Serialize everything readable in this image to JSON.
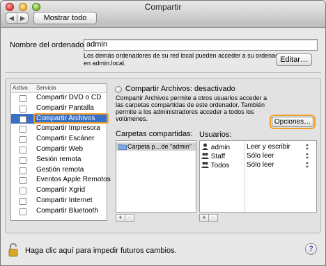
{
  "window": {
    "title": "Compartir",
    "show_all_label": "Mostrar todo",
    "back_glyph": "◀",
    "forward_glyph": "▶"
  },
  "computer": {
    "label": "Nombre del ordenador:",
    "value": "admin",
    "hint_line1": "Los demás ordenadores de su red local pueden acceder a su ordenador",
    "hint_line2": "en admin.local.",
    "edit_label": "Editar…"
  },
  "services": {
    "col_active": "Activo",
    "col_service": "Servicio",
    "selected_index": 2,
    "items": [
      {
        "name": "Compartir DVD o CD",
        "active": false
      },
      {
        "name": "Compartir Pantalla",
        "active": false
      },
      {
        "name": "Compartir Archivos",
        "active": false
      },
      {
        "name": "Compartir Impresora",
        "active": false
      },
      {
        "name": "Compartir Escáner",
        "active": false
      },
      {
        "name": "Compartir Web",
        "active": false
      },
      {
        "name": "Sesión remota",
        "active": false
      },
      {
        "name": "Gestión remota",
        "active": false
      },
      {
        "name": "Eventos Apple Remotos",
        "active": false
      },
      {
        "name": "Compartir Xgrid",
        "active": false
      },
      {
        "name": "Compartir Internet",
        "active": false
      },
      {
        "name": "Compartir Bluetooth",
        "active": false
      }
    ]
  },
  "detail": {
    "status": "Compartir Archivos: desactivado",
    "description_line1": "Compartir Archivos permite a otros usuarios acceder a",
    "description_line2": "las carpetas compartidas de este ordenador. También",
    "description_line3": "permite a los administradores acceder a todos los",
    "description_line4": "volúmenes.",
    "options_label": "Opciones…",
    "folders_label": "Carpetas compartidas:",
    "folders": [
      "Carpeta p…de \"admin\""
    ],
    "users_label": "Usuarios:",
    "users": [
      {
        "name": "admin",
        "permission": "Leer y escribir",
        "icon": "single-user-icon"
      },
      {
        "name": "Staff",
        "permission": "Sólo leer",
        "icon": "group-icon"
      },
      {
        "name": "Todos",
        "permission": "Sólo leer",
        "icon": "group-icon"
      }
    ],
    "add_glyph": "+",
    "remove_glyph": "−"
  },
  "footer": {
    "lock_text": "Haga clic aquí para impedir futuros cambios.",
    "help_glyph": "?"
  },
  "colors": {
    "selection": "#3a6fc6",
    "focus_ring": "#f2a02a"
  }
}
